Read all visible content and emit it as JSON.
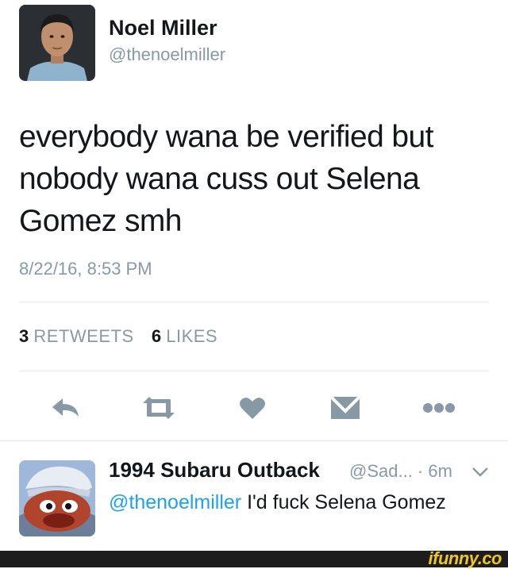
{
  "tweet": {
    "author_name": "Noel Miller",
    "author_handle": "@thenoelmiller",
    "text": "everybody wana be verified but nobody wana cuss out Selena Gomez smh",
    "timestamp": "8/22/16, 8:53 PM",
    "retweets_count": "3",
    "retweets_label": "RETWEETS",
    "likes_count": "6",
    "likes_label": "LIKES"
  },
  "actions": [
    {
      "icon": "reply-icon"
    },
    {
      "icon": "retweet-icon"
    },
    {
      "icon": "like-heart-icon"
    },
    {
      "icon": "direct-message-icon"
    },
    {
      "icon": "more-icon"
    }
  ],
  "reply": {
    "author_name": "1994 Subaru Outback",
    "meta": "@Sad... · 6m",
    "mention": "@thenoelmiller",
    "text": " I'd fuck Selena Gomez"
  },
  "watermark": "ifunny.co",
  "colors": {
    "text": "#14171a",
    "secondary": "#8899a6",
    "link": "#1da1f2",
    "icon": "#8899a6",
    "watermark": "#f2c71b"
  }
}
